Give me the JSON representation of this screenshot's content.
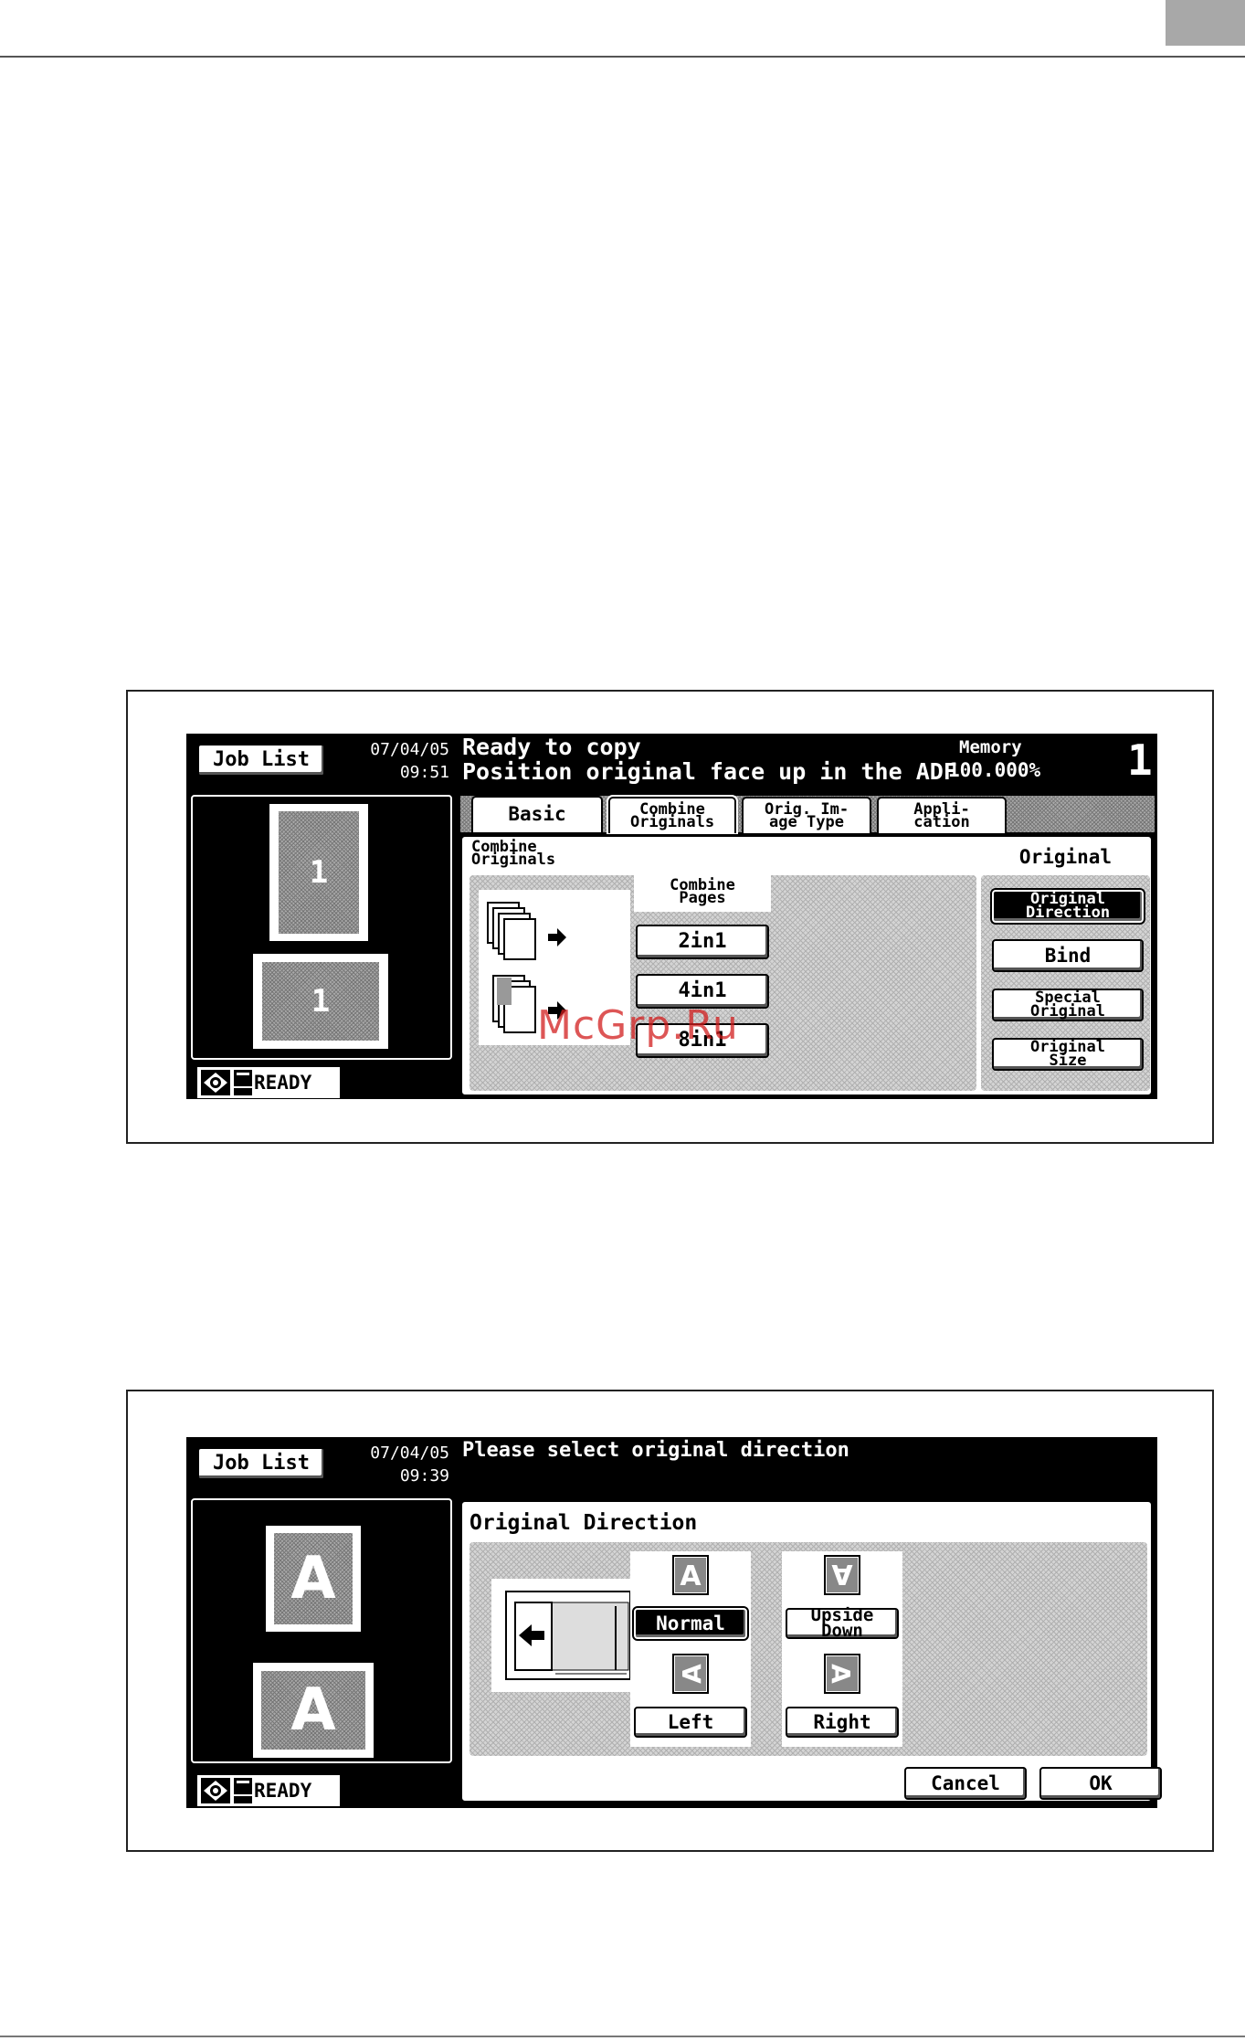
{
  "screen1": {
    "job_list_label": "Job List",
    "date": "07/04/05",
    "time": "09:51",
    "message_line1": "Ready to copy",
    "message_line2": "Position original face up in the ADF",
    "memory_label": "Memory",
    "memory_value": "100.000%",
    "copy_count": "1",
    "preview_page_number_portrait": "1",
    "preview_page_number_landscape": "1",
    "status": "READY",
    "tabs": [
      {
        "label": "Basic"
      },
      {
        "label": "Combine\nOriginals"
      },
      {
        "label": "Orig. Im-\nage Type"
      },
      {
        "label": "Appli-\ncation"
      }
    ],
    "combine_section_label": "Combine\nOriginals",
    "combine_pages_label": "Combine\nPages",
    "combine_buttons": [
      {
        "label": "2in1"
      },
      {
        "label": "4in1"
      },
      {
        "label": "8in1"
      }
    ],
    "original_section_label": "Original",
    "original_buttons": [
      {
        "label": "Original\nDirection"
      },
      {
        "label": "Bind"
      },
      {
        "label": "Special\nOriginal"
      },
      {
        "label": "Original\nSize"
      }
    ],
    "watermark": "McGrp.Ru"
  },
  "screen2": {
    "job_list_label": "Job List",
    "date": "07/04/05",
    "time": "09:39",
    "message": "Please select original direction",
    "preview_letter_portrait": "A",
    "preview_letter_landscape": "A",
    "status": "READY",
    "section_title": "Original Direction",
    "direction_options": [
      {
        "label": "Normal",
        "icon": "letter-a-normal-icon",
        "selected": true
      },
      {
        "label": "Upside Down",
        "icon": "letter-a-upside-down-icon",
        "selected": false
      },
      {
        "label": "Left",
        "icon": "letter-a-left-icon",
        "selected": false
      },
      {
        "label": "Right",
        "icon": "letter-a-right-icon",
        "selected": false
      }
    ],
    "cancel_label": "Cancel",
    "ok_label": "OK"
  }
}
